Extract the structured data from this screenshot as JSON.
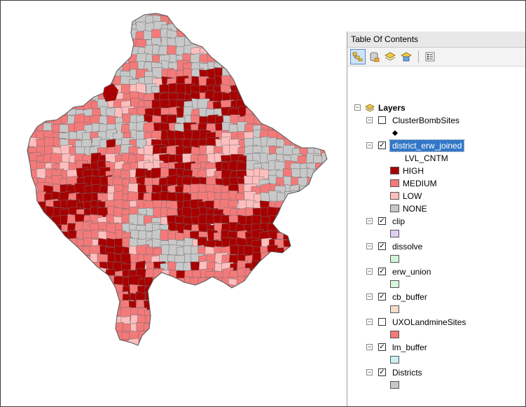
{
  "toc": {
    "title": "Table Of Contents",
    "toolbar": [
      {
        "icon": "list-by-drawing-order-icon",
        "active": true
      },
      {
        "icon": "list-by-source-icon",
        "active": false
      },
      {
        "icon": "list-by-visibility-icon",
        "active": false
      },
      {
        "icon": "list-by-selection-icon",
        "active": false
      },
      {
        "icon": "options-icon",
        "active": false
      }
    ],
    "root": {
      "label": "Layers",
      "icon": "layers-icon",
      "expanded": true
    },
    "layers": [
      {
        "label": "ClusterBombSites",
        "checked": false,
        "symbol": {
          "type": "point",
          "color": "#000000"
        }
      },
      {
        "label": "district_erw_joined",
        "checked": true,
        "selected": true,
        "field": "LVL_CNTM",
        "classes": [
          {
            "label": "HIGH",
            "color": "#a80000"
          },
          {
            "label": "MEDIUM",
            "color": "#f47a7a"
          },
          {
            "label": "LOW",
            "color": "#ffbebe"
          },
          {
            "label": "NONE",
            "color": "#c8c8c8"
          }
        ]
      },
      {
        "label": "clip",
        "checked": true,
        "symbol": {
          "type": "fill",
          "color": "#e0cdf0"
        }
      },
      {
        "label": "dissolve",
        "checked": true,
        "symbol": {
          "type": "fill",
          "color": "#d2f5dc"
        }
      },
      {
        "label": "erw_union",
        "checked": true,
        "symbol": {
          "type": "fill",
          "color": "#d7f7dc"
        }
      },
      {
        "label": "cb_buffer",
        "checked": true,
        "symbol": {
          "type": "fill",
          "color": "#f7dcc8"
        }
      },
      {
        "label": "UXOLandmineSites",
        "checked": false,
        "symbol": {
          "type": "fill",
          "color": "#f47a7a"
        }
      },
      {
        "label": "lm_buffer",
        "checked": true,
        "symbol": {
          "type": "fill",
          "color": "#c8f0f0"
        }
      },
      {
        "label": "Districts",
        "checked": true,
        "symbol": {
          "type": "fill",
          "color": "#c8c8c8"
        }
      }
    ]
  },
  "map": {
    "colors": {
      "HIGH": "#a80000",
      "MEDIUM": "#f47a7a",
      "LOW": "#ffbebe",
      "NONE": "#c8c8c8",
      "outline": "#6e6e6e"
    }
  }
}
